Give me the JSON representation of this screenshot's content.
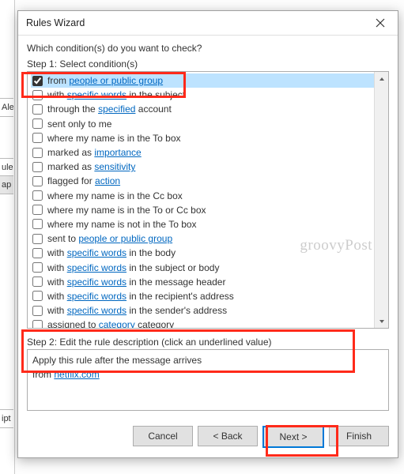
{
  "window": {
    "title": "Rules Wizard",
    "close_icon": "close"
  },
  "prompt": "Which condition(s) do you want to check?",
  "step1_label": "Step 1: Select condition(s)",
  "conditions": [
    {
      "checked": true,
      "pre": "from ",
      "link": "people or public group",
      "post": "",
      "selected": true
    },
    {
      "checked": false,
      "pre": "with ",
      "link": "specific words",
      "post": " in the subject"
    },
    {
      "checked": false,
      "pre": "through the ",
      "link": "specified",
      "post": " account"
    },
    {
      "checked": false,
      "pre": "sent only to me",
      "link": "",
      "post": ""
    },
    {
      "checked": false,
      "pre": "where my name is in the To box",
      "link": "",
      "post": ""
    },
    {
      "checked": false,
      "pre": "marked as ",
      "link": "importance",
      "post": ""
    },
    {
      "checked": false,
      "pre": "marked as ",
      "link": "sensitivity",
      "post": ""
    },
    {
      "checked": false,
      "pre": "flagged for ",
      "link": "action",
      "post": ""
    },
    {
      "checked": false,
      "pre": "where my name is in the Cc box",
      "link": "",
      "post": ""
    },
    {
      "checked": false,
      "pre": "where my name is in the To or Cc box",
      "link": "",
      "post": ""
    },
    {
      "checked": false,
      "pre": "where my name is not in the To box",
      "link": "",
      "post": ""
    },
    {
      "checked": false,
      "pre": "sent to ",
      "link": "people or public group",
      "post": ""
    },
    {
      "checked": false,
      "pre": "with ",
      "link": "specific words",
      "post": " in the body"
    },
    {
      "checked": false,
      "pre": "with ",
      "link": "specific words",
      "post": " in the subject or body"
    },
    {
      "checked": false,
      "pre": "with ",
      "link": "specific words",
      "post": " in the message header"
    },
    {
      "checked": false,
      "pre": "with ",
      "link": "specific words",
      "post": " in the recipient's address"
    },
    {
      "checked": false,
      "pre": "with ",
      "link": "specific words",
      "post": " in the sender's address"
    },
    {
      "checked": false,
      "pre": "assigned to ",
      "link": "category",
      "post": " category"
    }
  ],
  "step2_label": "Step 2: Edit the rule description (click an underlined value)",
  "description": {
    "line1": "Apply this rule after the message arrives",
    "line2_pre": "from ",
    "line2_link": "netflix.com"
  },
  "buttons": {
    "cancel": "Cancel",
    "back": "< Back",
    "next": "Next >",
    "finish": "Finish"
  },
  "left_fragments": {
    "ale": "Ale",
    "rul": "ule",
    "ap": "ap",
    "ipt": "ipt"
  },
  "watermark": "groovyPost"
}
